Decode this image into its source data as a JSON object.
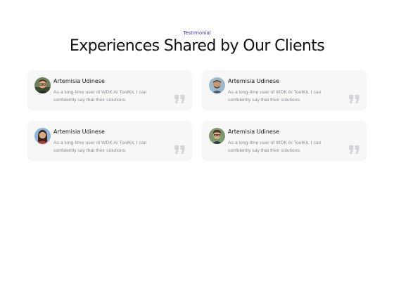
{
  "section": {
    "eyebrow": "Testimonial",
    "title": "Experiences Shared by Our Clients"
  },
  "testimonials": [
    {
      "name": "Artemisia Udinese",
      "line1": "As a long-time user of WDK AI ToolKit, I can",
      "line2": "confidently say that their solutions.",
      "avatar": "avatar-man-glasses"
    },
    {
      "name": "Artemisia Udinese",
      "line1": "As a long-time user of WDK AI ToolKit, I can",
      "line2": "confidently say that their solutions.",
      "avatar": "avatar-man-beard"
    },
    {
      "name": "Artemisia Udinese",
      "line1": "As a long-time user of WDK AI ToolKit, I can",
      "line2": "confidently say that their solutions.",
      "avatar": "avatar-woman"
    },
    {
      "name": "Artemisia Udinese",
      "line1": "As a long-time user of WDK AI ToolKit, I can",
      "line2": "confidently say that their solutions.",
      "avatar": "avatar-man-curly"
    }
  ],
  "colors": {
    "accent": "#3b2fd4",
    "card_bg": "#f7f7f8",
    "quote_icon": "#d4d4d8"
  },
  "icons": {
    "quote": "quote-mark-icon"
  }
}
